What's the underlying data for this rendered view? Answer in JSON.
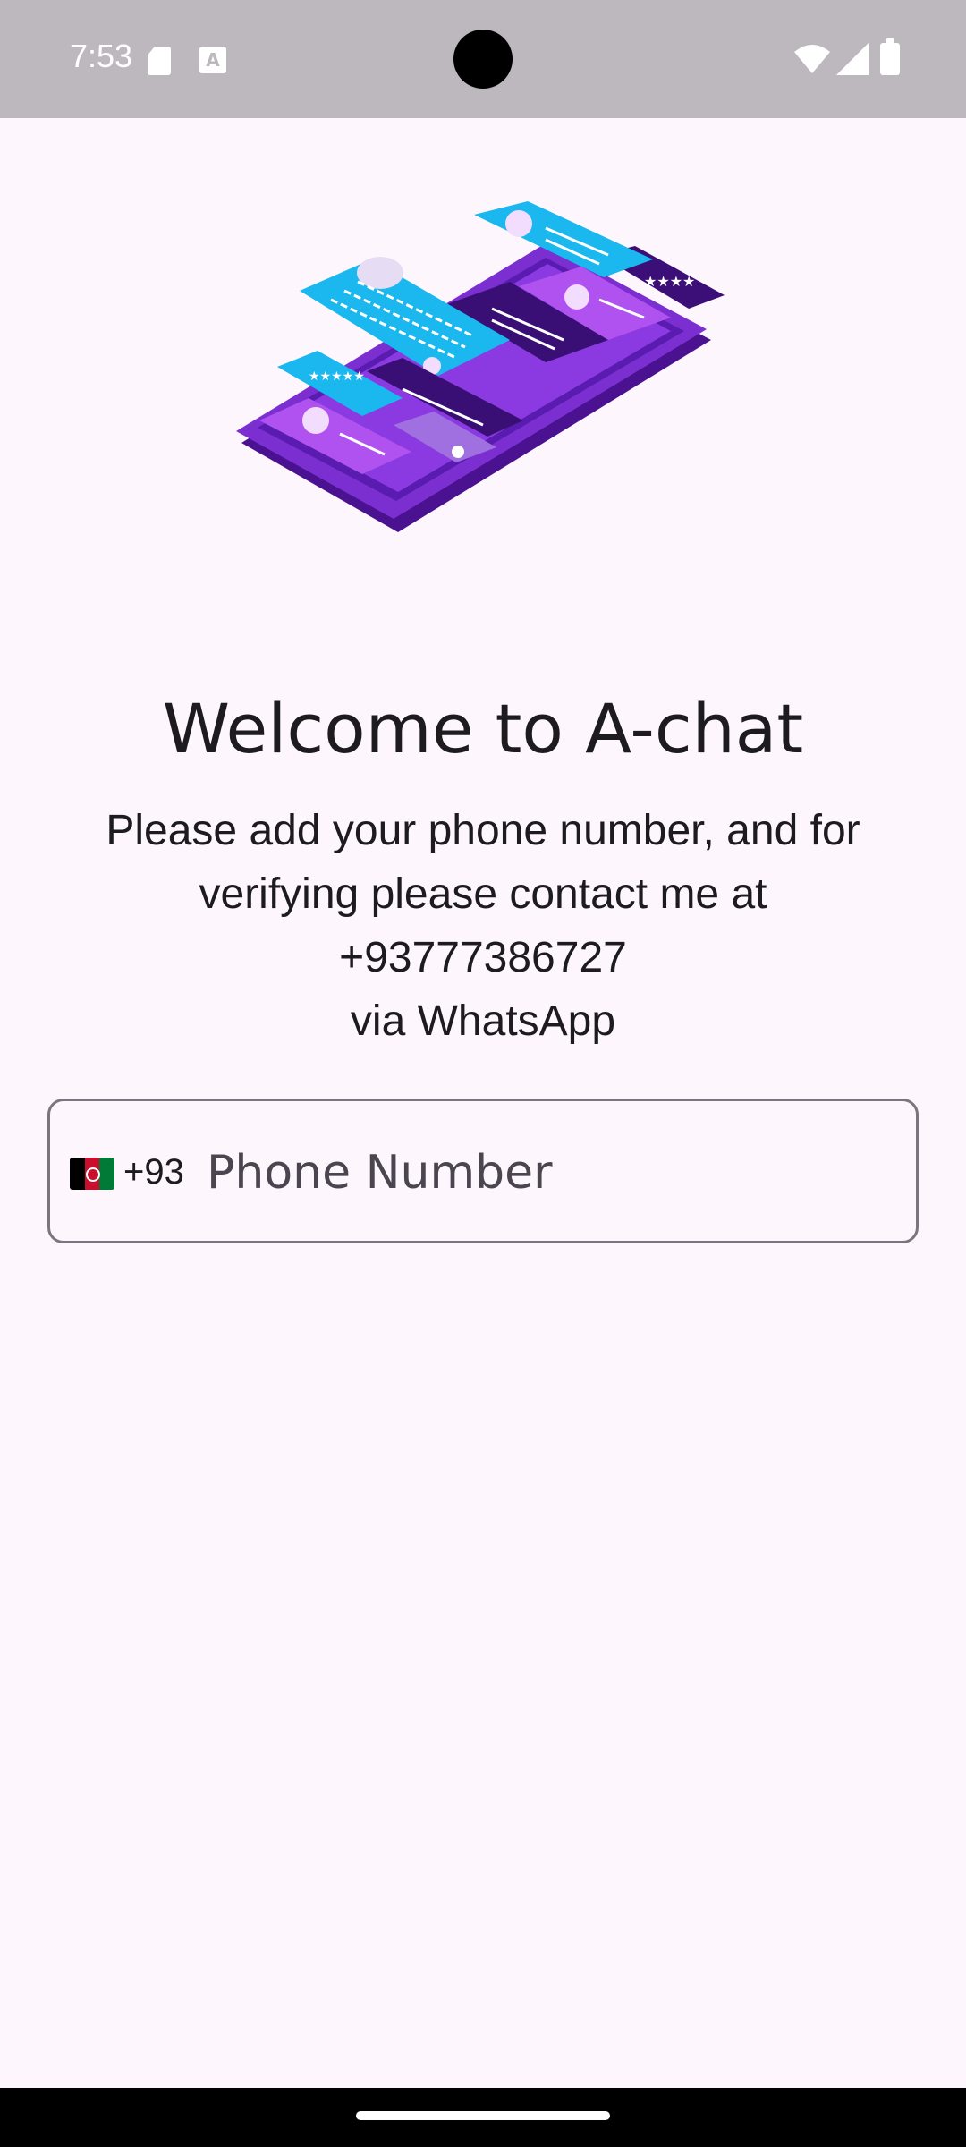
{
  "status_bar": {
    "time": "7:53",
    "icons": [
      "sd-card-icon",
      "a-text-icon",
      "wifi-icon",
      "signal-icon",
      "battery-icon"
    ]
  },
  "hero": {
    "icon": "phone-chat-illustration"
  },
  "welcome": {
    "title": "Welcome to A-chat",
    "line1": "Please add your phone number, and for",
    "line2": "verifying please contact me at",
    "line3": "+93777386727",
    "line4": "via WhatsApp"
  },
  "phone_field": {
    "country_flag": "afghanistan-flag-icon",
    "dial_code": "+93",
    "placeholder": "Phone Number",
    "value": ""
  },
  "colors": {
    "background": "#fdf6fd",
    "status_bar": "#bcb8bd",
    "text": "#1d1b1e",
    "field_border": "#7a757f",
    "accent_purple": "#7b2fd0",
    "accent_cyan": "#1ab8ef"
  }
}
